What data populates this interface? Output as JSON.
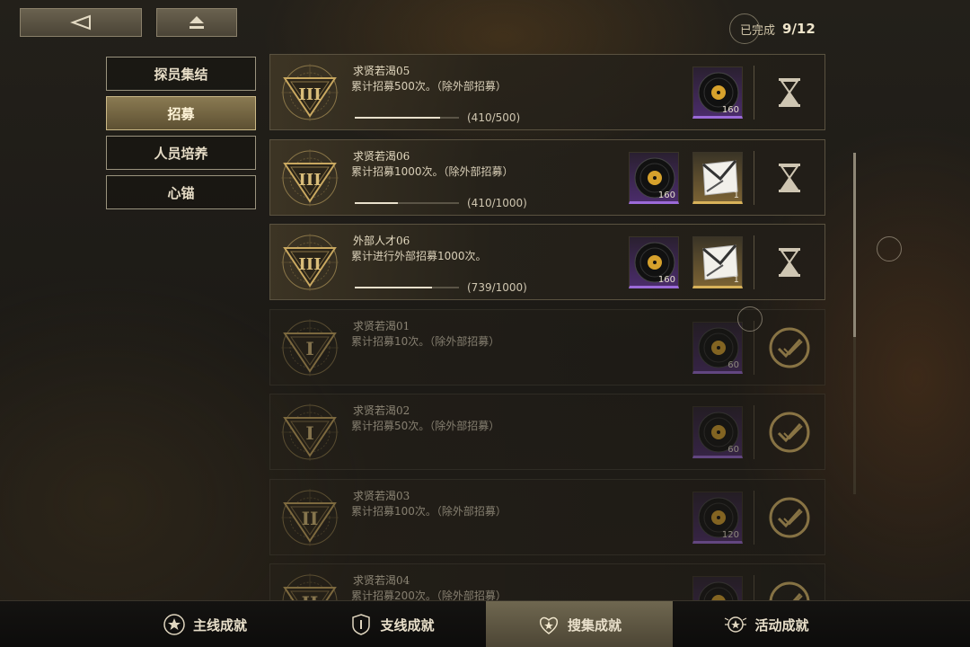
{
  "top": {
    "back_icon": "back-arrow-icon",
    "home_icon": "eject-home-icon",
    "completed_label": "已完成",
    "completed_value": "9/12"
  },
  "menu": {
    "items": [
      {
        "label": "探员集结",
        "active": false
      },
      {
        "label": "招募",
        "active": true
      },
      {
        "label": "人员培养",
        "active": false
      },
      {
        "label": "心锚",
        "active": false
      }
    ]
  },
  "achievements": [
    {
      "title": "求贤若渴05",
      "desc": "累计招募500次。（除外部招募）",
      "tier": "III",
      "progress_text": "(410/500)",
      "progress": 0.82,
      "done": false,
      "rewards": [
        {
          "type": "purple",
          "icon": "vinyl-record-icon",
          "count": "160"
        }
      ]
    },
    {
      "title": "求贤若渴06",
      "desc": "累计招募1000次。（除外部招募）",
      "tier": "III",
      "progress_text": "(410/1000)",
      "progress": 0.41,
      "done": false,
      "rewards": [
        {
          "type": "purple",
          "icon": "vinyl-record-icon",
          "count": "160"
        },
        {
          "type": "gold",
          "icon": "envelope-card-icon",
          "count": "1"
        }
      ]
    },
    {
      "title": "外部人才06",
      "desc": "累计进行外部招募1000次。",
      "tier": "III",
      "progress_text": "(739/1000)",
      "progress": 0.739,
      "done": false,
      "rewards": [
        {
          "type": "purple",
          "icon": "vinyl-record-icon",
          "count": "160"
        },
        {
          "type": "gold",
          "icon": "envelope-card-icon",
          "count": "1"
        }
      ]
    },
    {
      "title": "求贤若渴01",
      "desc": "累计招募10次。（除外部招募）",
      "tier": "I",
      "progress_text": "",
      "progress": 1,
      "done": true,
      "rewards": [
        {
          "type": "purple",
          "icon": "vinyl-record-icon",
          "count": "60"
        }
      ]
    },
    {
      "title": "求贤若渴02",
      "desc": "累计招募50次。（除外部招募）",
      "tier": "I",
      "progress_text": "",
      "progress": 1,
      "done": true,
      "rewards": [
        {
          "type": "purple",
          "icon": "vinyl-record-icon",
          "count": "60"
        }
      ]
    },
    {
      "title": "求贤若渴03",
      "desc": "累计招募100次。（除外部招募）",
      "tier": "II",
      "progress_text": "",
      "progress": 1,
      "done": true,
      "rewards": [
        {
          "type": "purple",
          "icon": "vinyl-record-icon",
          "count": "120"
        }
      ]
    },
    {
      "title": "求贤若渴04",
      "desc": "累计招募200次。（除外部招募）",
      "tier": "II",
      "progress_text": "",
      "progress": 1,
      "done": true,
      "rewards": [
        {
          "type": "purple",
          "icon": "vinyl-record-icon",
          "count": ""
        }
      ]
    }
  ],
  "tabs": [
    {
      "label": "主线成就",
      "icon": "shield-star-icon",
      "active": false
    },
    {
      "label": "支线成就",
      "icon": "shield-icon",
      "active": false
    },
    {
      "label": "搜集成就",
      "icon": "heart-star-icon",
      "active": true
    },
    {
      "label": "活动成就",
      "icon": "winged-star-icon",
      "active": false
    }
  ]
}
